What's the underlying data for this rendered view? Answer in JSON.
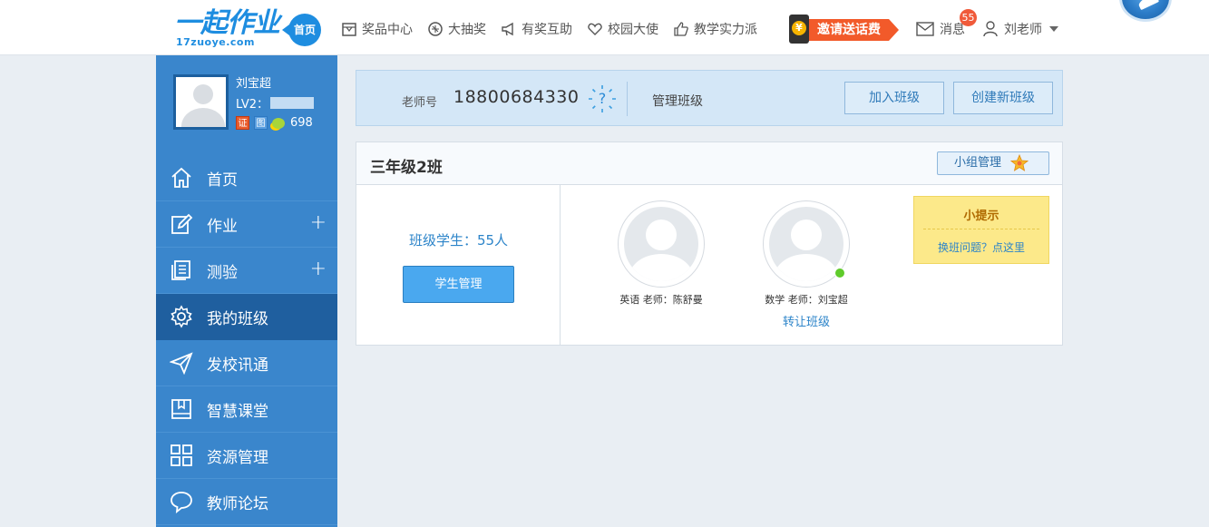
{
  "header": {
    "logo_text": "一起作业",
    "logo_sub": "17zuoye.com",
    "home_badge": "首页",
    "nav": [
      {
        "label": "奖品中心",
        "icon": "gift-box-icon"
      },
      {
        "label": "大抽奖",
        "icon": "lottery-icon"
      },
      {
        "label": "有奖互助",
        "icon": "megaphone-icon"
      },
      {
        "label": "校园大使",
        "icon": "heart-icon"
      },
      {
        "label": "教学实力派",
        "icon": "thumbs-up-icon"
      }
    ],
    "invite_label": "邀请送话费",
    "messages_label": "消息",
    "messages_count": "55",
    "user_label": "刘老师"
  },
  "sidebar": {
    "name": "刘宝超",
    "level_prefix": "LV2：",
    "badge_cert": "证",
    "badge_blue": "图",
    "beans": "698",
    "menu": [
      {
        "label": "首页",
        "icon": "home-icon",
        "expandable": false,
        "active": false
      },
      {
        "label": "作业",
        "icon": "pencil-edit-icon",
        "expandable": true,
        "active": false
      },
      {
        "label": "测验",
        "icon": "document-stack-icon",
        "expandable": true,
        "active": false
      },
      {
        "label": "我的班级",
        "icon": "gear-icon",
        "expandable": false,
        "active": true
      },
      {
        "label": "发校讯通",
        "icon": "paper-plane-icon",
        "expandable": false,
        "active": false
      },
      {
        "label": "智慧课堂",
        "icon": "book-icon",
        "expandable": false,
        "active": false
      },
      {
        "label": "资源管理",
        "icon": "grid-icon",
        "expandable": false,
        "active": false
      },
      {
        "label": "教师论坛",
        "icon": "chat-bubble-icon",
        "expandable": false,
        "active": false
      }
    ]
  },
  "teacher_bar": {
    "label": "老师号",
    "number": "18800684330",
    "manage_label": "管理班级",
    "join_button": "加入班级",
    "create_button": "创建新班级"
  },
  "class_card": {
    "title": "三年级2班",
    "group_button": "小组管理",
    "student_count": "班级学生：55人",
    "student_button": "学生管理",
    "teachers": [
      {
        "caption": "英语 老师：陈舒曼",
        "online": false,
        "transfer": ""
      },
      {
        "caption": "数学 老师：刘宝超",
        "online": true,
        "transfer": "转让班级"
      }
    ],
    "tips_title": "小提示",
    "tips_link": "换班问题？点这里"
  },
  "colors": {
    "brand_blue": "#1e8de0",
    "sidebar_blue": "#3a86cc",
    "sidebar_active": "#1f5f9f",
    "invite_orange": "#f25a2a",
    "online_green": "#5fcb2b"
  }
}
